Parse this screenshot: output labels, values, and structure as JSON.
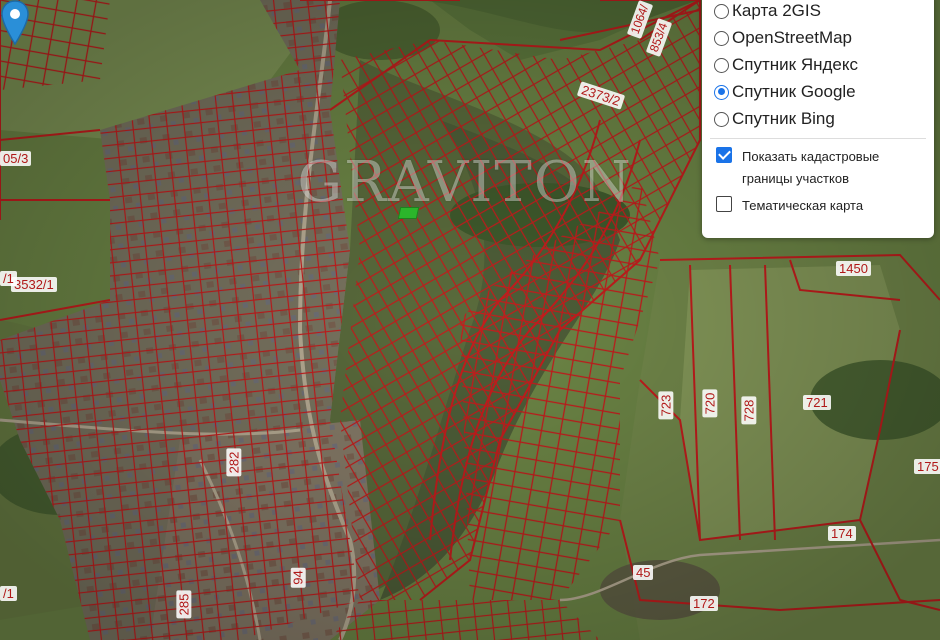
{
  "map": {
    "watermark": "GRAVITON",
    "plot_labels": [
      {
        "text": "1064/"
      },
      {
        "text": "853/4"
      },
      {
        "text": "2373/2"
      },
      {
        "text": "05/3"
      },
      {
        "text": "3532/1"
      },
      {
        "text": "/1"
      },
      {
        "text": "1450"
      },
      {
        "text": "723"
      },
      {
        "text": "720"
      },
      {
        "text": "728"
      },
      {
        "text": "721"
      },
      {
        "text": "282"
      },
      {
        "text": "175"
      },
      {
        "text": "174"
      },
      {
        "text": "45"
      },
      {
        "text": "94"
      },
      {
        "text": "285"
      },
      {
        "text": "172"
      },
      {
        "text": "/1"
      }
    ]
  },
  "layer_panel": {
    "base_layers": [
      {
        "label": "Карта 2GIS",
        "selected": false
      },
      {
        "label": "OpenStreetMap",
        "selected": false
      },
      {
        "label": "Спутник Яндекс",
        "selected": false
      },
      {
        "label": "Спутник Google",
        "selected": true
      },
      {
        "label": "Спутник Bing",
        "selected": false
      }
    ],
    "overlays": [
      {
        "label": "Показать кадастровые границы участков",
        "checked": true
      },
      {
        "label": "Тематическая карта",
        "checked": false
      }
    ]
  },
  "colors": {
    "boundary": "#c51d1d",
    "accent": "#1a73e8",
    "marker": "#2bb52b"
  }
}
